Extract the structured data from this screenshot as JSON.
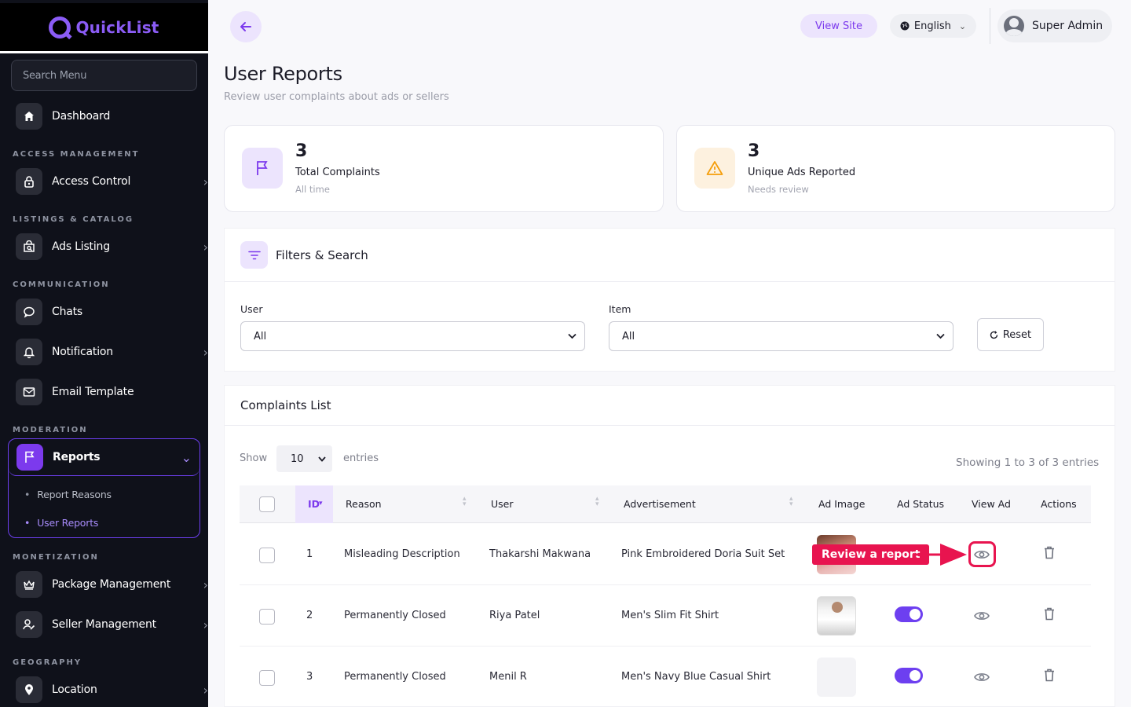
{
  "brand": {
    "name": "QuickList"
  },
  "sidebar": {
    "search_placeholder": "Search Menu",
    "dashboard": "Dashboard",
    "sec_access": "ACCESS MANAGEMENT",
    "access_control": "Access Control",
    "sec_listings": "LISTINGS & CATALOG",
    "ads_listing": "Ads Listing",
    "sec_comm": "COMMUNICATION",
    "chats": "Chats",
    "notification": "Notification",
    "email_template": "Email Template",
    "sec_moderation": "MODERATION",
    "reports": "Reports",
    "report_reasons": "Report Reasons",
    "user_reports": "User Reports",
    "sec_monetization": "MONETIZATION",
    "package_management": "Package Management",
    "seller_management": "Seller Management",
    "sec_geography": "GEOGRAPHY",
    "location": "Location"
  },
  "topbar": {
    "view_site": "View Site",
    "language": "English",
    "user": "Super Admin"
  },
  "page": {
    "title": "User Reports",
    "subtitle": "Review user complaints about ads or sellers"
  },
  "stats": [
    {
      "value": "3",
      "label": "Total Complaints",
      "hint": "All time"
    },
    {
      "value": "3",
      "label": "Unique Ads Reported",
      "hint": "Needs review"
    }
  ],
  "filters": {
    "title": "Filters & Search",
    "user_label": "User",
    "user_value": "All",
    "item_label": "Item",
    "item_value": "All",
    "reset": "Reset"
  },
  "complaints": {
    "title": "Complaints List",
    "show": "Show",
    "page_size": "10",
    "entries": "entries",
    "summary": "Showing 1 to 3 of 3 entries",
    "columns": [
      "ID",
      "Reason",
      "User",
      "Advertisement",
      "Ad Image",
      "Ad Status",
      "View Ad",
      "Actions"
    ],
    "rows": [
      {
        "id": "1",
        "reason": "Misleading Description",
        "user": "Thakarshi Makwana",
        "ad": "Pink Embroidered Doria Suit Set"
      },
      {
        "id": "2",
        "reason": "Permanently Closed",
        "user": "Riya Patel",
        "ad": "Men's Slim Fit Shirt"
      },
      {
        "id": "3",
        "reason": "Permanently Closed",
        "user": "Menil R",
        "ad": "Men's Navy Blue Casual Shirt"
      }
    ],
    "callout": "Review a report"
  },
  "colors": {
    "accent": "#7c3aed",
    "highlight": "#e8144f",
    "sidebar_bg": "#0f111a"
  }
}
